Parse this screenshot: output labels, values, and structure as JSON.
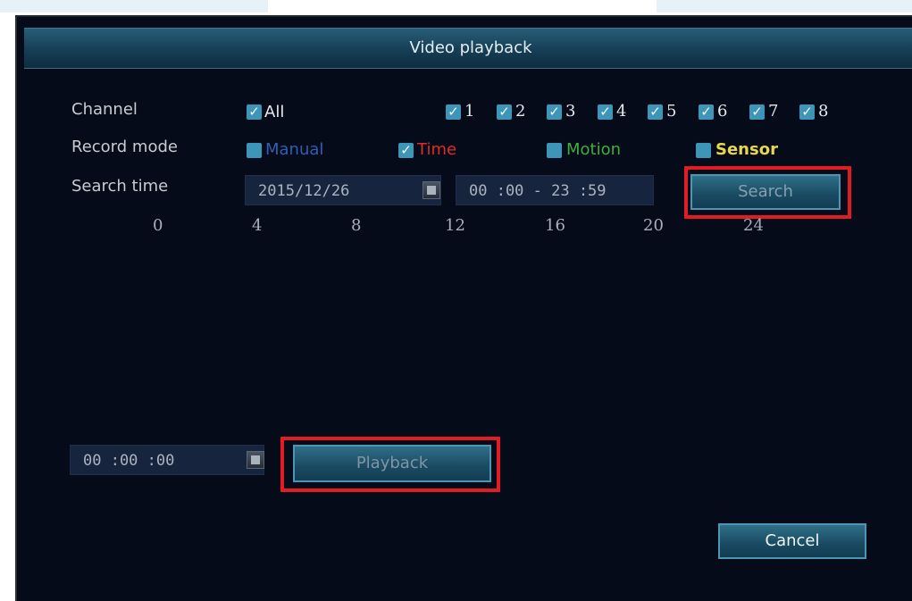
{
  "title": "Video playback",
  "channel": {
    "label": "Channel",
    "all": {
      "label": "All",
      "checked": true
    },
    "items": [
      {
        "label": "1",
        "checked": true
      },
      {
        "label": "2",
        "checked": true
      },
      {
        "label": "3",
        "checked": true
      },
      {
        "label": "4",
        "checked": true
      },
      {
        "label": "5",
        "checked": true
      },
      {
        "label": "6",
        "checked": true
      },
      {
        "label": "7",
        "checked": true
      },
      {
        "label": "8",
        "checked": true
      }
    ]
  },
  "record_mode": {
    "label": "Record mode",
    "modes": [
      {
        "label": "Manual",
        "checked": false,
        "color": "#2f5fb5"
      },
      {
        "label": "Time",
        "checked": true,
        "color": "#e02b2b"
      },
      {
        "label": "Motion",
        "checked": false,
        "color": "#3fae3f"
      },
      {
        "label": "Sensor",
        "checked": false,
        "color": "#e8d74a"
      }
    ]
  },
  "search_time": {
    "label": "Search time",
    "date": "2015/12/26",
    "time_range": "00 :00 - 23 :59"
  },
  "buttons": {
    "search": "Search",
    "playback": "Playback",
    "cancel": "Cancel"
  },
  "timeline": {
    "ticks": [
      "0",
      "4",
      "8",
      "12",
      "16",
      "20",
      "24"
    ]
  },
  "playback_time": "00 :00 :00",
  "colors": {
    "accent": "#3d96b8",
    "highlight": "#e21b24"
  }
}
